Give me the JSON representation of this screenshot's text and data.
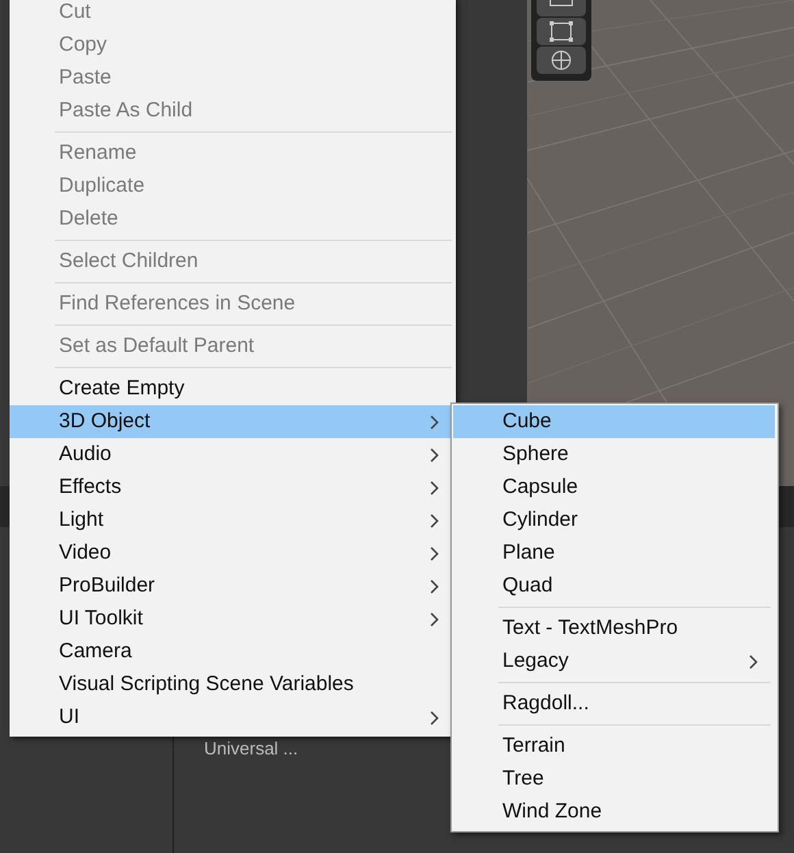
{
  "background": {
    "panel_label": "Universal ..."
  },
  "context_menu": {
    "items": [
      {
        "kind": "item",
        "label": "Cut",
        "disabled": true,
        "selected": false,
        "has_submenu": false
      },
      {
        "kind": "item",
        "label": "Copy",
        "disabled": true,
        "selected": false,
        "has_submenu": false
      },
      {
        "kind": "item",
        "label": "Paste",
        "disabled": true,
        "selected": false,
        "has_submenu": false
      },
      {
        "kind": "item",
        "label": "Paste As Child",
        "disabled": true,
        "selected": false,
        "has_submenu": false
      },
      {
        "kind": "separator"
      },
      {
        "kind": "item",
        "label": "Rename",
        "disabled": true,
        "selected": false,
        "has_submenu": false
      },
      {
        "kind": "item",
        "label": "Duplicate",
        "disabled": true,
        "selected": false,
        "has_submenu": false
      },
      {
        "kind": "item",
        "label": "Delete",
        "disabled": true,
        "selected": false,
        "has_submenu": false
      },
      {
        "kind": "separator"
      },
      {
        "kind": "item",
        "label": "Select Children",
        "disabled": true,
        "selected": false,
        "has_submenu": false
      },
      {
        "kind": "separator"
      },
      {
        "kind": "item",
        "label": "Find References in Scene",
        "disabled": true,
        "selected": false,
        "has_submenu": false
      },
      {
        "kind": "separator"
      },
      {
        "kind": "item",
        "label": "Set as Default Parent",
        "disabled": true,
        "selected": false,
        "has_submenu": false
      },
      {
        "kind": "separator"
      },
      {
        "kind": "item",
        "label": "Create Empty",
        "disabled": false,
        "selected": false,
        "has_submenu": false
      },
      {
        "kind": "item",
        "label": "3D Object",
        "disabled": false,
        "selected": true,
        "has_submenu": true
      },
      {
        "kind": "item",
        "label": "Audio",
        "disabled": false,
        "selected": false,
        "has_submenu": true
      },
      {
        "kind": "item",
        "label": "Effects",
        "disabled": false,
        "selected": false,
        "has_submenu": true
      },
      {
        "kind": "item",
        "label": "Light",
        "disabled": false,
        "selected": false,
        "has_submenu": true
      },
      {
        "kind": "item",
        "label": "Video",
        "disabled": false,
        "selected": false,
        "has_submenu": true
      },
      {
        "kind": "item",
        "label": "ProBuilder",
        "disabled": false,
        "selected": false,
        "has_submenu": true
      },
      {
        "kind": "item",
        "label": "UI Toolkit",
        "disabled": false,
        "selected": false,
        "has_submenu": true
      },
      {
        "kind": "item",
        "label": "Camera",
        "disabled": false,
        "selected": false,
        "has_submenu": false
      },
      {
        "kind": "item",
        "label": "Visual Scripting Scene Variables",
        "disabled": false,
        "selected": false,
        "has_submenu": false
      },
      {
        "kind": "item",
        "label": "UI",
        "disabled": false,
        "selected": false,
        "has_submenu": true
      }
    ]
  },
  "submenu": {
    "items": [
      {
        "kind": "item",
        "label": "Cube",
        "disabled": false,
        "selected": true,
        "has_submenu": false
      },
      {
        "kind": "item",
        "label": "Sphere",
        "disabled": false,
        "selected": false,
        "has_submenu": false
      },
      {
        "kind": "item",
        "label": "Capsule",
        "disabled": false,
        "selected": false,
        "has_submenu": false
      },
      {
        "kind": "item",
        "label": "Cylinder",
        "disabled": false,
        "selected": false,
        "has_submenu": false
      },
      {
        "kind": "item",
        "label": "Plane",
        "disabled": false,
        "selected": false,
        "has_submenu": false
      },
      {
        "kind": "item",
        "label": "Quad",
        "disabled": false,
        "selected": false,
        "has_submenu": false
      },
      {
        "kind": "separator"
      },
      {
        "kind": "item",
        "label": "Text - TextMeshPro",
        "disabled": false,
        "selected": false,
        "has_submenu": false
      },
      {
        "kind": "item",
        "label": "Legacy",
        "disabled": false,
        "selected": false,
        "has_submenu": true
      },
      {
        "kind": "separator"
      },
      {
        "kind": "item",
        "label": "Ragdoll...",
        "disabled": false,
        "selected": false,
        "has_submenu": false
      },
      {
        "kind": "separator"
      },
      {
        "kind": "item",
        "label": "Terrain",
        "disabled": false,
        "selected": false,
        "has_submenu": false
      },
      {
        "kind": "item",
        "label": "Tree",
        "disabled": false,
        "selected": false,
        "has_submenu": false
      },
      {
        "kind": "item",
        "label": "Wind Zone",
        "disabled": false,
        "selected": false,
        "has_submenu": false
      }
    ]
  }
}
